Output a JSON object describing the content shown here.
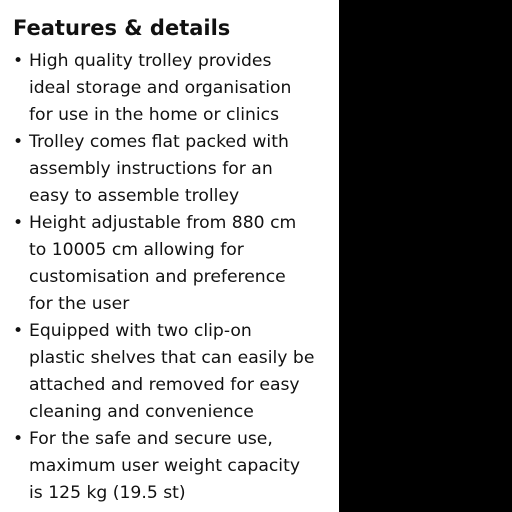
{
  "panel": {
    "title": "Features & details",
    "bullet_glyph": "•",
    "features": [
      {
        "lines": [
          "High quality trolley provides",
          "ideal storage and organisation",
          "for use in the home or clinics"
        ]
      },
      {
        "lines": [
          "Trolley comes flat packed with",
          "assembly instructions for an",
          "easy to assemble trolley"
        ]
      },
      {
        "lines": [
          "Height adjustable from 880 cm",
          "to 10005 cm allowing for",
          "customisation and preference",
          "for the user"
        ]
      },
      {
        "lines": [
          "Equipped with two clip-on",
          "plastic shelves that can easily be",
          "attached and removed for easy",
          "cleaning and convenience"
        ]
      },
      {
        "lines": [
          "For the safe and secure use,",
          "maximum user weight capacity",
          "is 125 kg (19.5 st)"
        ]
      }
    ]
  },
  "colors": {
    "text": "#111111",
    "panel_background": "#ffffff",
    "outer_background": "#000000"
  }
}
